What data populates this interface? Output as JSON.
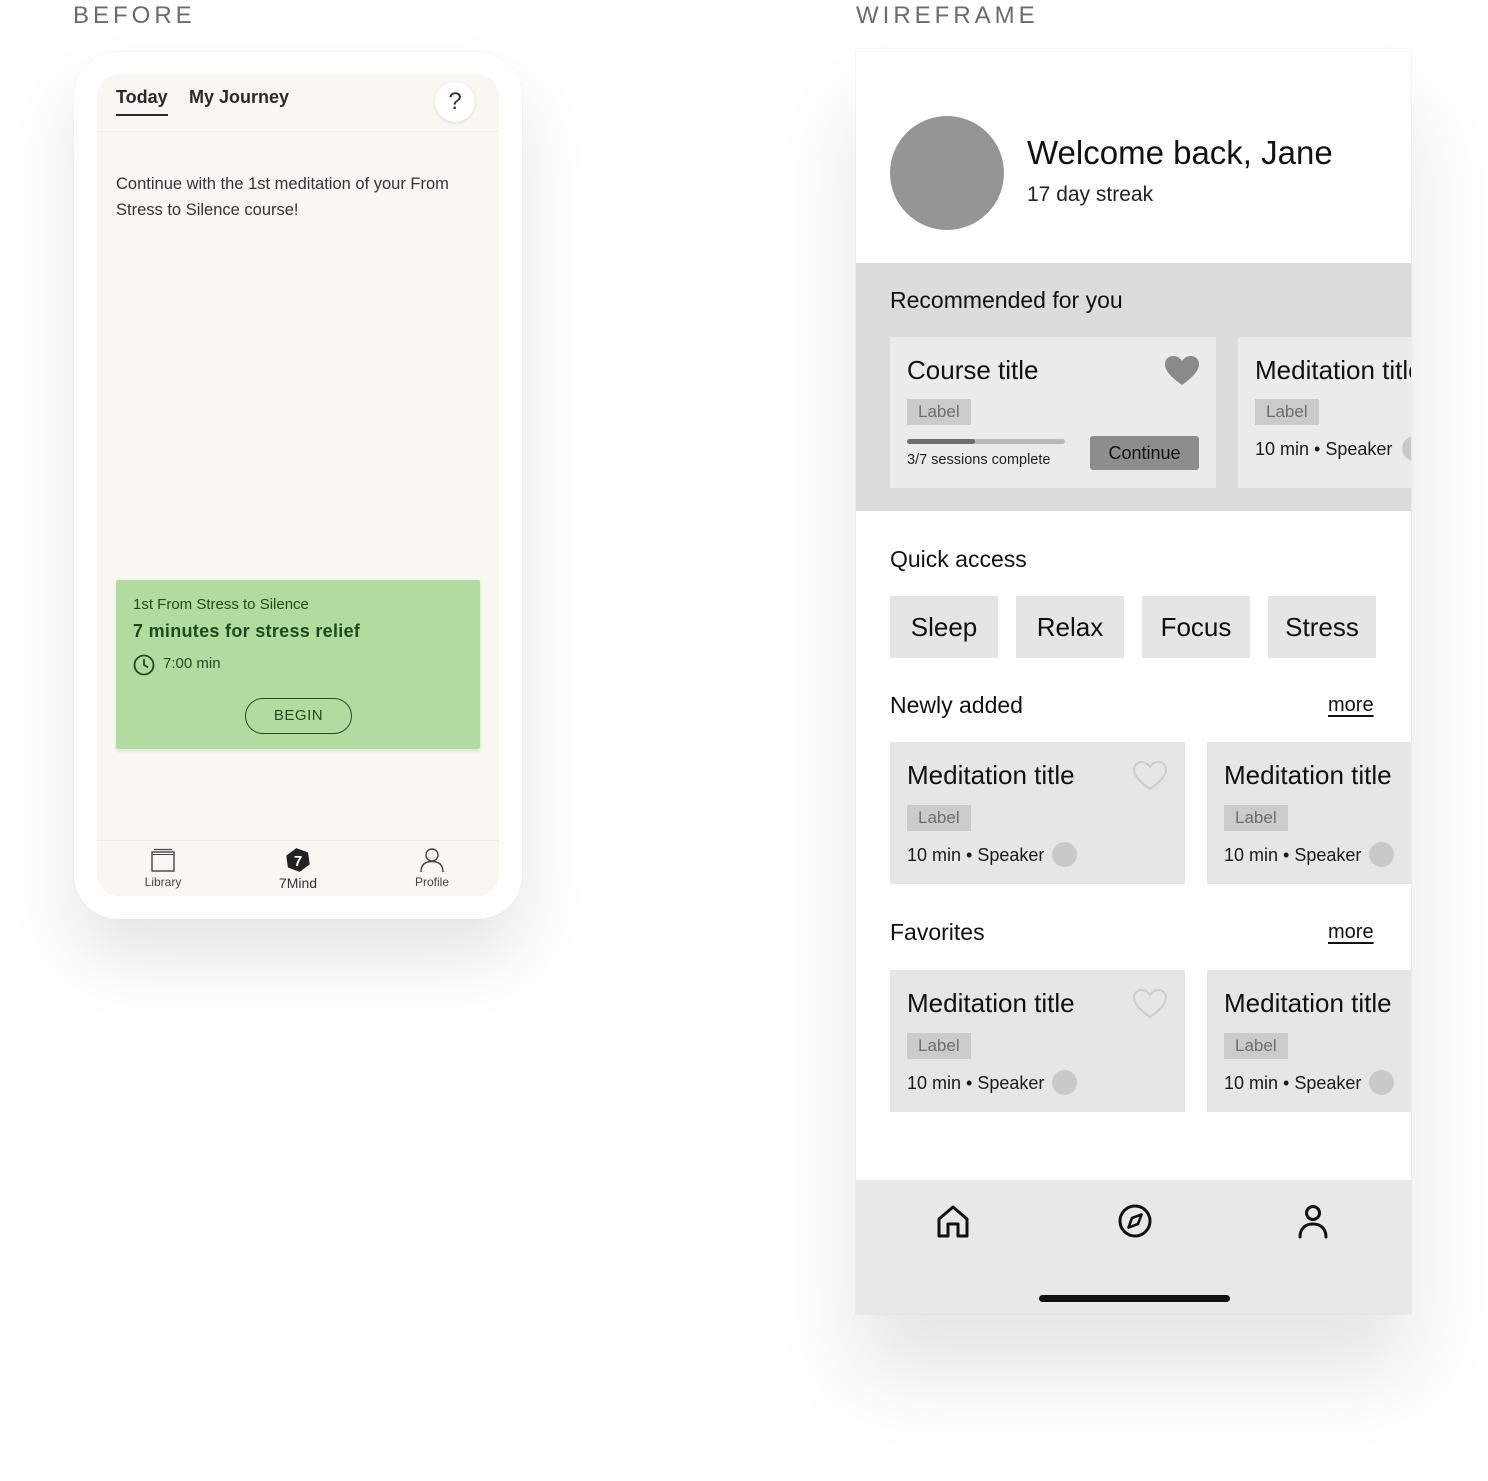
{
  "labels": {
    "before": "BEFORE",
    "wireframe": "WIREFRAME"
  },
  "before": {
    "tabs": {
      "today": "Today",
      "my_journey": "My Journey"
    },
    "help_icon": "?",
    "message": "Continue with the 1st meditation of your From Stress to Silence course!",
    "card": {
      "subtitle": "1st From Stress to Silence",
      "title": "7 minutes for stress relief",
      "duration": "7:00 min",
      "button": "BEGIN",
      "bg_color": "#b0dd9f"
    },
    "nav": {
      "library": "Library",
      "seven_mind": "7Mind",
      "seven_mind_glyph": "7",
      "profile": "Profile"
    }
  },
  "wireframe": {
    "welcome": "Welcome back, Jane",
    "streak": "17 day streak",
    "recommended": {
      "title": "Recommended for you",
      "course": {
        "title": "Course title",
        "label": "Label",
        "progress": 0.43,
        "sessions": "3/7 sessions complete",
        "button": "Continue"
      },
      "meditation": {
        "title": "Meditation title",
        "label": "Label",
        "meta": "10 min • Speaker"
      }
    },
    "quick_access": {
      "title": "Quick access",
      "chips": [
        "Sleep",
        "Relax",
        "Focus",
        "Stress"
      ]
    },
    "newly_added": {
      "title": "Newly added",
      "more": "more",
      "cards": [
        {
          "title": "Meditation title",
          "label": "Label",
          "meta": "10 min • Speaker"
        },
        {
          "title": "Meditation title",
          "label": "Label",
          "meta": "10 min • Speaker"
        }
      ]
    },
    "favorites": {
      "title": "Favorites",
      "more": "more",
      "cards": [
        {
          "title": "Meditation title",
          "label": "Label",
          "meta": "10 min • Speaker"
        },
        {
          "title": "Meditation title",
          "label": "Label",
          "meta": "10 min • Speaker"
        }
      ]
    },
    "nav_icons": [
      "home-icon",
      "compass-icon",
      "user-icon"
    ]
  }
}
